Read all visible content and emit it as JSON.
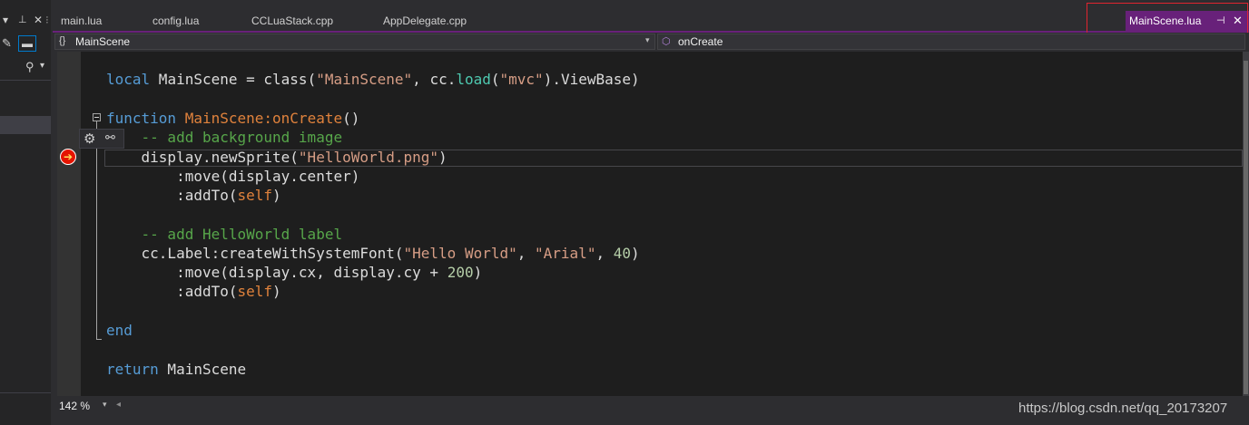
{
  "left_panel": {
    "dropdown_arrow": "▾",
    "pin_icon": "📌",
    "close_icon": "✕",
    "overflow": "⁝",
    "wrench_icon": "🔧",
    "search_icon": "⚲",
    "search_dropdown": "▾"
  },
  "tabs": [
    {
      "label": "main.lua"
    },
    {
      "label": "config.lua"
    },
    {
      "label": "CCLuaStack.cpp"
    },
    {
      "label": "AppDelegate.cpp"
    }
  ],
  "active_tab": {
    "label": "MainScene.lua",
    "pin_icon": "⊣",
    "close_icon": "✕"
  },
  "navbar": {
    "scope_icon": "{}",
    "scope": "MainScene",
    "member_icon": "⬡",
    "member": "onCreate",
    "arrow": "▾"
  },
  "code": {
    "line1": {
      "kw": "local",
      "a": " MainScene = class(",
      "s1": "\"MainScene\"",
      "b": ", cc.",
      "m": "load",
      "c": "(",
      "s2": "\"mvc\"",
      "d": ").ViewBase)"
    },
    "line3": {
      "kw": "function",
      "sp": " ",
      "fn": "MainScene:onCreate",
      "rest": "()"
    },
    "line4": "    -- add background image",
    "line5": {
      "a": "    display.newSprite(",
      "s": "\"HelloWorld.png\"",
      "b": ")"
    },
    "line6": "        :move(display.center)",
    "line7": {
      "a": "        :addTo(",
      "self": "self",
      "b": ")"
    },
    "line9": "    -- add HelloWorld label",
    "line10": {
      "a": "    cc.Label:createWithSystemFont(",
      "s1": "\"Hello World\"",
      "b": ", ",
      "s2": "\"Arial\"",
      "c": ", ",
      "n": "40",
      "d": ")"
    },
    "line11": {
      "a": "        :move(display.cx, display.cy + ",
      "n": "200",
      "b": ")"
    },
    "line12": {
      "a": "        :addTo(",
      "self": "self",
      "b": ")"
    },
    "line14": "end",
    "line16": {
      "kw": "return",
      "rest": " MainScene"
    }
  },
  "lightbulb": {
    "gear": "⚙",
    "wrench": "🔗"
  },
  "breakpoint_arrow": "➔",
  "zoom": {
    "value": "142 %",
    "arrow": "▾"
  },
  "hscroll_left": "◂",
  "watermark": "https://blog.csdn.net/qq_20173207",
  "colors": {
    "accent": "#68217a",
    "highlight_box": "#e0242f",
    "breakpoint": "#e51400"
  }
}
